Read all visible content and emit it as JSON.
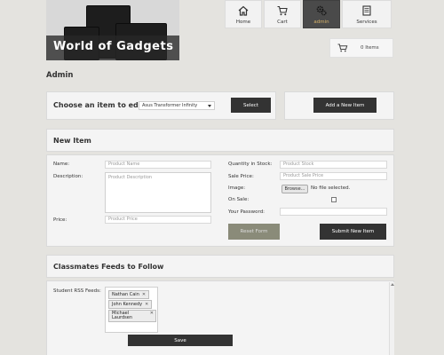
{
  "site": {
    "logo_text": "World of Gadgets"
  },
  "nav": [
    {
      "label": "Home",
      "icon": "home-icon",
      "active": false
    },
    {
      "label": "Cart",
      "icon": "cart-icon",
      "active": false
    },
    {
      "label": "admin",
      "icon": "gears-icon",
      "active": true
    },
    {
      "label": "Services",
      "icon": "document-icon",
      "active": false
    }
  ],
  "cart": {
    "count_text": "0 Items"
  },
  "page": {
    "title": "Admin"
  },
  "choose": {
    "label": "Choose an item to edit:",
    "selected": "Asus Transformer Infinity",
    "select_button": "Select",
    "add_button": "Add a New Item"
  },
  "new_item": {
    "title": "New Item",
    "name_label": "Name:",
    "name_placeholder": "Product Name",
    "description_label": "Description:",
    "description_placeholder": "Product Description",
    "price_label": "Price:",
    "price_placeholder": "Product Price",
    "quantity_label": "Quantity in Stock:",
    "quantity_placeholder": "Product Stock",
    "sale_price_label": "Sale Price:",
    "sale_price_placeholder": "Product Sale Price",
    "image_label": "Image:",
    "browse_button": "Browse...",
    "file_status": "No file selected.",
    "on_sale_label": "On Sale:",
    "password_label": "Your Password:",
    "reset_button": "Reset Form",
    "submit_button": "Submit New Item"
  },
  "feeds": {
    "title": "Classmates Feeds to Follow",
    "label": "Student RSS Feeds:",
    "tags": [
      "Nathan Cain",
      "John Kennedy",
      "Michael Laurdsen"
    ],
    "save_button": "Save"
  },
  "colors": {
    "background": "#e4e3df",
    "panel": "#f4f4f4",
    "dark_button": "#333333",
    "reset_button": "#8a8b79",
    "active_nav": "#4a4a4a",
    "active_nav_text": "#d7b36a"
  }
}
